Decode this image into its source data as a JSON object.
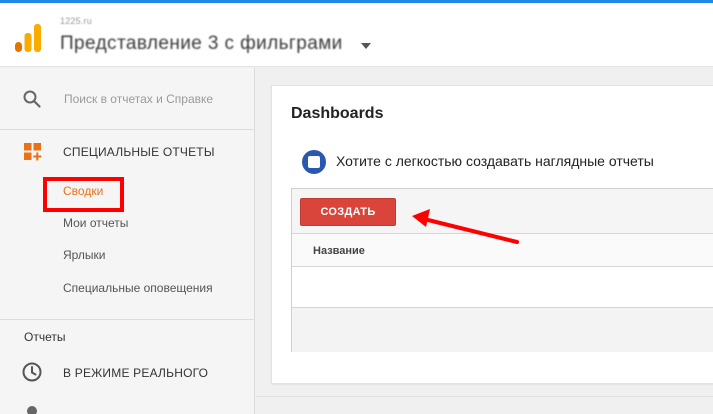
{
  "header": {
    "account_small": "1225.ru",
    "view_name": "Представление 3 с фильграми"
  },
  "sidebar": {
    "search_placeholder": "Поиск в отчетах и Справке",
    "custom_reports": {
      "title": "СПЕЦИАЛЬНЫЕ ОТЧЕТЫ",
      "items": [
        {
          "label": "Сводки",
          "active": true
        },
        {
          "label": "Мои отчеты"
        },
        {
          "label": "Ярлыки"
        },
        {
          "label": "Специальные оповещения"
        }
      ]
    },
    "reports_label": "Отчеты",
    "realtime_label": "В РЕЖИМЕ РЕАЛЬНОГО"
  },
  "main": {
    "title": "Dashboards",
    "promo_text": "Хотите с легкостью создавать наглядные отчеты",
    "create_label": "СОЗДАТЬ",
    "column_name": "Название"
  },
  "colors": {
    "accent_orange": "#e8711c",
    "create_red": "#d9453a",
    "annotation_red": "#ff0000",
    "top_bar_blue": "#1e88e5"
  }
}
